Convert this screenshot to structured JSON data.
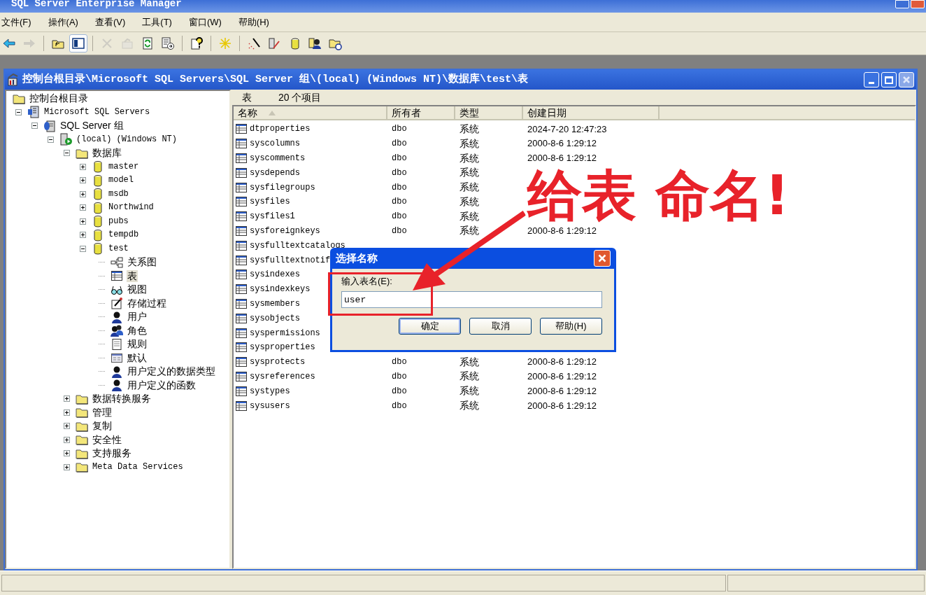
{
  "app": {
    "title": "SQL Server Enterprise Manager"
  },
  "menu": [
    "文件(F)",
    "操作(A)",
    "查看(V)",
    "工具(T)",
    "窗口(W)",
    "帮助(H)"
  ],
  "toolbar": [
    {
      "kind": "back",
      "disabled": false,
      "pressed": false
    },
    {
      "kind": "forward",
      "disabled": true,
      "pressed": false
    },
    {
      "kind": "separator"
    },
    {
      "kind": "up",
      "disabled": false,
      "pressed": false
    },
    {
      "kind": "tree",
      "disabled": false,
      "pressed": true
    },
    {
      "kind": "separator"
    },
    {
      "kind": "delete",
      "disabled": true,
      "pressed": false
    },
    {
      "kind": "properties",
      "disabled": true,
      "pressed": false
    },
    {
      "kind": "refresh",
      "disabled": false,
      "pressed": false
    },
    {
      "kind": "export",
      "disabled": false,
      "pressed": false
    },
    {
      "kind": "separator"
    },
    {
      "kind": "help",
      "disabled": false,
      "pressed": false
    },
    {
      "kind": "separator"
    },
    {
      "kind": "new",
      "disabled": false,
      "pressed": false
    },
    {
      "kind": "separator"
    },
    {
      "kind": "wizard",
      "disabled": false,
      "pressed": false
    },
    {
      "kind": "edit",
      "disabled": false,
      "pressed": false
    },
    {
      "kind": "database",
      "disabled": false,
      "pressed": false
    },
    {
      "kind": "users",
      "disabled": false,
      "pressed": false
    },
    {
      "kind": "folder",
      "disabled": false,
      "pressed": false
    }
  ],
  "window": {
    "title": "控制台根目录\\Microsoft SQL Servers\\SQL Server 组\\(local) (Windows NT)\\数据库\\test\\表"
  },
  "tree": [
    {
      "label": "控制台根目录",
      "kind": "folder",
      "selected": false,
      "children": [
        {
          "label": "Microsoft SQL Servers",
          "kind": "servers",
          "expanded": true,
          "selected": false,
          "children": [
            {
              "label": "SQL Server 组",
              "kind": "group",
              "expanded": true,
              "selected": false,
              "children": [
                {
                  "label": "(local) (Windows NT)",
                  "kind": "server",
                  "expanded": true,
                  "selected": false,
                  "children": [
                    {
                      "label": "数据库",
                      "kind": "folder",
                      "expanded": true,
                      "selected": false,
                      "children": [
                        {
                          "label": "master",
                          "kind": "database",
                          "expanded": false,
                          "selected": false
                        },
                        {
                          "label": "model",
                          "kind": "database",
                          "expanded": false,
                          "selected": false
                        },
                        {
                          "label": "msdb",
                          "kind": "database",
                          "expanded": false,
                          "selected": false
                        },
                        {
                          "label": "Northwind",
                          "kind": "database",
                          "expanded": false,
                          "selected": false
                        },
                        {
                          "label": "pubs",
                          "kind": "database",
                          "expanded": false,
                          "selected": false
                        },
                        {
                          "label": "tempdb",
                          "kind": "database",
                          "expanded": false,
                          "selected": false
                        },
                        {
                          "label": "test",
                          "kind": "database",
                          "expanded": true,
                          "selected": false,
                          "children": [
                            {
                              "label": "关系图",
                              "kind": "diagram",
                              "selected": false
                            },
                            {
                              "label": "表",
                              "kind": "table",
                              "selected": true
                            },
                            {
                              "label": "视图",
                              "kind": "view",
                              "selected": false
                            },
                            {
                              "label": "存储过程",
                              "kind": "procedure",
                              "selected": false
                            },
                            {
                              "label": "用户",
                              "kind": "user",
                              "selected": false
                            },
                            {
                              "label": "角色",
                              "kind": "role",
                              "selected": false
                            },
                            {
                              "label": "规则",
                              "kind": "rule",
                              "selected": false
                            },
                            {
                              "label": "默认",
                              "kind": "default",
                              "selected": false
                            },
                            {
                              "label": "用户定义的数据类型",
                              "kind": "user",
                              "selected": false
                            },
                            {
                              "label": "用户定义的函数",
                              "kind": "user",
                              "selected": false
                            }
                          ]
                        }
                      ]
                    },
                    {
                      "label": "数据转换服务",
                      "kind": "folder",
                      "expanded": false,
                      "selected": false
                    },
                    {
                      "label": "管理",
                      "kind": "folder",
                      "expanded": false,
                      "selected": false
                    },
                    {
                      "label": "复制",
                      "kind": "folder",
                      "expanded": false,
                      "selected": false
                    },
                    {
                      "label": "安全性",
                      "kind": "folder",
                      "expanded": false,
                      "selected": false
                    },
                    {
                      "label": "支持服务",
                      "kind": "folder",
                      "expanded": false,
                      "selected": false
                    },
                    {
                      "label": "Meta Data Services",
                      "kind": "folder",
                      "expanded": false,
                      "selected": false
                    }
                  ]
                }
              ]
            }
          ]
        }
      ]
    }
  ],
  "list": {
    "section": "表",
    "count": "20 个项目",
    "columns": [
      {
        "label": "名称",
        "sorted": true
      },
      {
        "label": "所有者",
        "sorted": false
      },
      {
        "label": "类型",
        "sorted": false
      },
      {
        "label": "创建日期",
        "sorted": false
      }
    ],
    "rows": [
      {
        "name": "dtproperties",
        "owner": "dbo",
        "type": "系统",
        "created": "2024-7-20 12:47:23"
      },
      {
        "name": "syscolumns",
        "owner": "dbo",
        "type": "系统",
        "created": "2000-8-6 1:29:12"
      },
      {
        "name": "syscomments",
        "owner": "dbo",
        "type": "系统",
        "created": "2000-8-6 1:29:12"
      },
      {
        "name": "sysdepends",
        "owner": "dbo",
        "type": "系统"
      },
      {
        "name": "sysfilegroups",
        "owner": "dbo",
        "type": "系统"
      },
      {
        "name": "sysfiles",
        "owner": "dbo",
        "type": "系统"
      },
      {
        "name": "sysfiles1",
        "owner": "dbo",
        "type": "系统"
      },
      {
        "name": "sysforeignkeys",
        "owner": "dbo",
        "type": "系统",
        "created": "2000-8-6 1:29:12"
      },
      {
        "name": "sysfulltextcatalogs"
      },
      {
        "name": "sysfulltextnotif"
      },
      {
        "name": "sysindexes"
      },
      {
        "name": "sysindexkeys"
      },
      {
        "name": "sysmembers"
      },
      {
        "name": "sysobjects"
      },
      {
        "name": "syspermissions"
      },
      {
        "name": "sysproperties"
      },
      {
        "name": "sysprotects",
        "owner": "dbo",
        "type": "系统",
        "created": "2000-8-6 1:29:12"
      },
      {
        "name": "sysreferences",
        "owner": "dbo",
        "type": "系统",
        "created": "2000-8-6 1:29:12"
      },
      {
        "name": "systypes",
        "owner": "dbo",
        "type": "系统",
        "created": "2000-8-6 1:29:12"
      },
      {
        "name": "sysusers",
        "owner": "dbo",
        "type": "系统",
        "created": "2000-8-6 1:29:12"
      }
    ]
  },
  "dialog": {
    "title": "选择名称",
    "label": "输入表名(E):",
    "value": "user",
    "buttons": [
      {
        "label": "确定",
        "default": true
      },
      {
        "label": "取消",
        "default": false
      },
      {
        "label": "帮助(H)",
        "default": false
      }
    ]
  },
  "annotation": {
    "text": "给表 命名!"
  }
}
